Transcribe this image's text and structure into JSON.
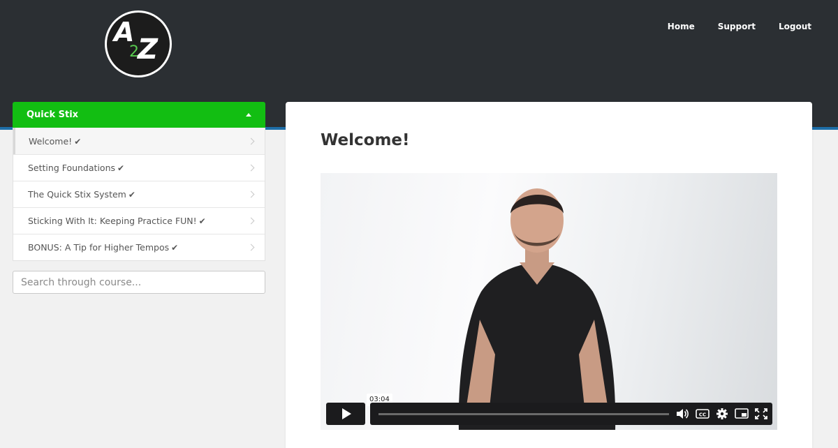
{
  "header": {
    "logo": {
      "text_a": "A",
      "text_2": "2",
      "text_z": "Z",
      "accent_color": "#58c94f"
    },
    "nav": [
      {
        "label": "Home"
      },
      {
        "label": "Support"
      },
      {
        "label": "Logout"
      }
    ]
  },
  "sidebar": {
    "course_title": "Quick Stix",
    "accent_color": "#12be12",
    "lessons": [
      {
        "label": "Welcome!",
        "completed": true,
        "active": true
      },
      {
        "label": "Setting Foundations",
        "completed": true
      },
      {
        "label": "The Quick Stix System",
        "completed": true
      },
      {
        "label": "Sticking With It: Keeping Practice FUN!",
        "completed": true
      },
      {
        "label": "BONUS: A Tip for Higher Tempos",
        "completed": true
      }
    ],
    "check_glyph": "✔",
    "search": {
      "placeholder": "Search through course...",
      "value": ""
    }
  },
  "main": {
    "title": "Welcome!",
    "video": {
      "hover_time": "03:04",
      "controls": [
        "play-icon",
        "volume-icon",
        "captions-icon",
        "settings-icon",
        "pip-icon",
        "fullscreen-icon"
      ]
    }
  }
}
